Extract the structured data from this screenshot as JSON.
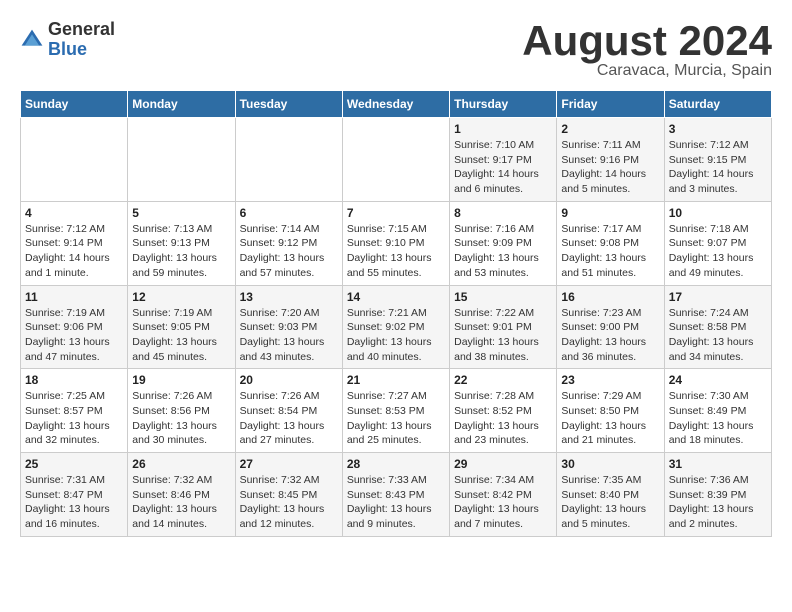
{
  "logo": {
    "general": "General",
    "blue": "Blue"
  },
  "title": "August 2024",
  "subtitle": "Caravaca, Murcia, Spain",
  "headers": [
    "Sunday",
    "Monday",
    "Tuesday",
    "Wednesday",
    "Thursday",
    "Friday",
    "Saturday"
  ],
  "weeks": [
    [
      {
        "day": "",
        "info": ""
      },
      {
        "day": "",
        "info": ""
      },
      {
        "day": "",
        "info": ""
      },
      {
        "day": "",
        "info": ""
      },
      {
        "day": "1",
        "info": "Sunrise: 7:10 AM\nSunset: 9:17 PM\nDaylight: 14 hours\nand 6 minutes."
      },
      {
        "day": "2",
        "info": "Sunrise: 7:11 AM\nSunset: 9:16 PM\nDaylight: 14 hours\nand 5 minutes."
      },
      {
        "day": "3",
        "info": "Sunrise: 7:12 AM\nSunset: 9:15 PM\nDaylight: 14 hours\nand 3 minutes."
      }
    ],
    [
      {
        "day": "4",
        "info": "Sunrise: 7:12 AM\nSunset: 9:14 PM\nDaylight: 14 hours\nand 1 minute."
      },
      {
        "day": "5",
        "info": "Sunrise: 7:13 AM\nSunset: 9:13 PM\nDaylight: 13 hours\nand 59 minutes."
      },
      {
        "day": "6",
        "info": "Sunrise: 7:14 AM\nSunset: 9:12 PM\nDaylight: 13 hours\nand 57 minutes."
      },
      {
        "day": "7",
        "info": "Sunrise: 7:15 AM\nSunset: 9:10 PM\nDaylight: 13 hours\nand 55 minutes."
      },
      {
        "day": "8",
        "info": "Sunrise: 7:16 AM\nSunset: 9:09 PM\nDaylight: 13 hours\nand 53 minutes."
      },
      {
        "day": "9",
        "info": "Sunrise: 7:17 AM\nSunset: 9:08 PM\nDaylight: 13 hours\nand 51 minutes."
      },
      {
        "day": "10",
        "info": "Sunrise: 7:18 AM\nSunset: 9:07 PM\nDaylight: 13 hours\nand 49 minutes."
      }
    ],
    [
      {
        "day": "11",
        "info": "Sunrise: 7:19 AM\nSunset: 9:06 PM\nDaylight: 13 hours\nand 47 minutes."
      },
      {
        "day": "12",
        "info": "Sunrise: 7:19 AM\nSunset: 9:05 PM\nDaylight: 13 hours\nand 45 minutes."
      },
      {
        "day": "13",
        "info": "Sunrise: 7:20 AM\nSunset: 9:03 PM\nDaylight: 13 hours\nand 43 minutes."
      },
      {
        "day": "14",
        "info": "Sunrise: 7:21 AM\nSunset: 9:02 PM\nDaylight: 13 hours\nand 40 minutes."
      },
      {
        "day": "15",
        "info": "Sunrise: 7:22 AM\nSunset: 9:01 PM\nDaylight: 13 hours\nand 38 minutes."
      },
      {
        "day": "16",
        "info": "Sunrise: 7:23 AM\nSunset: 9:00 PM\nDaylight: 13 hours\nand 36 minutes."
      },
      {
        "day": "17",
        "info": "Sunrise: 7:24 AM\nSunset: 8:58 PM\nDaylight: 13 hours\nand 34 minutes."
      }
    ],
    [
      {
        "day": "18",
        "info": "Sunrise: 7:25 AM\nSunset: 8:57 PM\nDaylight: 13 hours\nand 32 minutes."
      },
      {
        "day": "19",
        "info": "Sunrise: 7:26 AM\nSunset: 8:56 PM\nDaylight: 13 hours\nand 30 minutes."
      },
      {
        "day": "20",
        "info": "Sunrise: 7:26 AM\nSunset: 8:54 PM\nDaylight: 13 hours\nand 27 minutes."
      },
      {
        "day": "21",
        "info": "Sunrise: 7:27 AM\nSunset: 8:53 PM\nDaylight: 13 hours\nand 25 minutes."
      },
      {
        "day": "22",
        "info": "Sunrise: 7:28 AM\nSunset: 8:52 PM\nDaylight: 13 hours\nand 23 minutes."
      },
      {
        "day": "23",
        "info": "Sunrise: 7:29 AM\nSunset: 8:50 PM\nDaylight: 13 hours\nand 21 minutes."
      },
      {
        "day": "24",
        "info": "Sunrise: 7:30 AM\nSunset: 8:49 PM\nDaylight: 13 hours\nand 18 minutes."
      }
    ],
    [
      {
        "day": "25",
        "info": "Sunrise: 7:31 AM\nSunset: 8:47 PM\nDaylight: 13 hours\nand 16 minutes."
      },
      {
        "day": "26",
        "info": "Sunrise: 7:32 AM\nSunset: 8:46 PM\nDaylight: 13 hours\nand 14 minutes."
      },
      {
        "day": "27",
        "info": "Sunrise: 7:32 AM\nSunset: 8:45 PM\nDaylight: 13 hours\nand 12 minutes."
      },
      {
        "day": "28",
        "info": "Sunrise: 7:33 AM\nSunset: 8:43 PM\nDaylight: 13 hours\nand 9 minutes."
      },
      {
        "day": "29",
        "info": "Sunrise: 7:34 AM\nSunset: 8:42 PM\nDaylight: 13 hours\nand 7 minutes."
      },
      {
        "day": "30",
        "info": "Sunrise: 7:35 AM\nSunset: 8:40 PM\nDaylight: 13 hours\nand 5 minutes."
      },
      {
        "day": "31",
        "info": "Sunrise: 7:36 AM\nSunset: 8:39 PM\nDaylight: 13 hours\nand 2 minutes."
      }
    ]
  ]
}
